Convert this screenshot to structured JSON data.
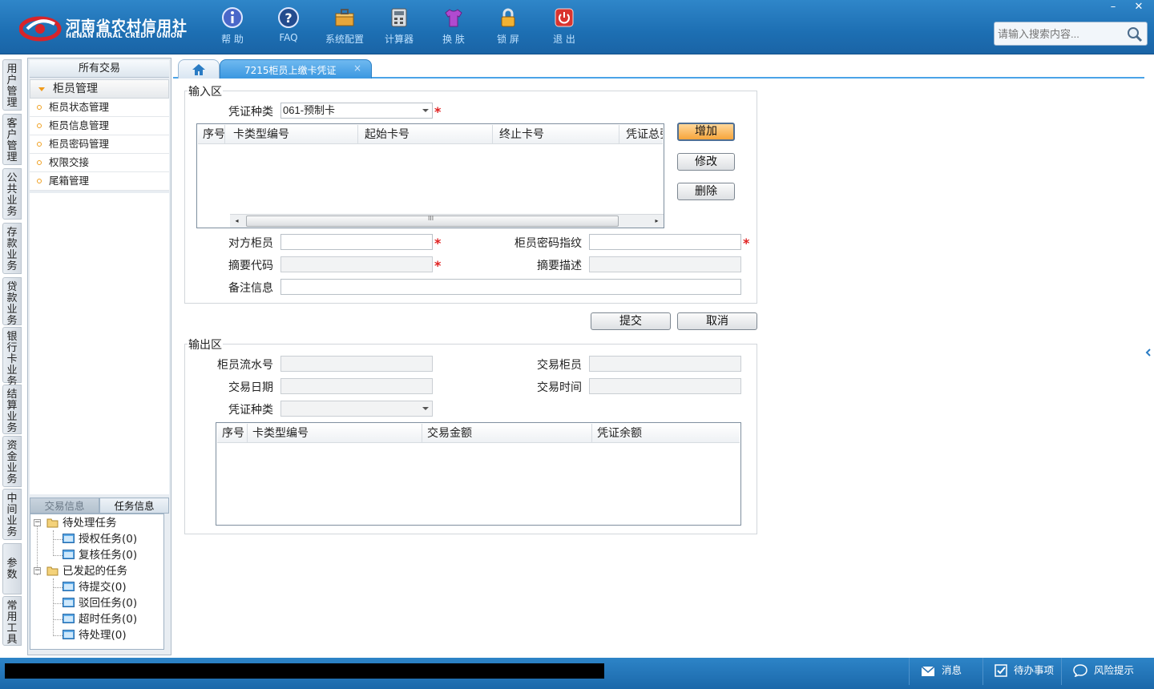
{
  "header": {
    "logo_cn": "河南省农村信用社",
    "logo_en": "HENAN RURAL CREDIT UNION",
    "tools": [
      {
        "label": "帮 助",
        "icon": "info-icon"
      },
      {
        "label": "FAQ",
        "icon": "question-icon"
      },
      {
        "label": "系统配置",
        "icon": "toolbox-icon"
      },
      {
        "label": "计算器",
        "icon": "calculator-icon"
      },
      {
        "label": "换 肤",
        "icon": "shirt-icon"
      },
      {
        "label": "锁 屏",
        "icon": "lock-icon"
      },
      {
        "label": "退 出",
        "icon": "power-icon"
      }
    ],
    "search_placeholder": "请输入搜索内容...",
    "minimize": "–",
    "close": "✕"
  },
  "vtabs": [
    "用户管理",
    "客户管理",
    "公共业务",
    "存款业务",
    "贷款业务",
    "银行卡业务",
    "结算业务",
    "资金业务",
    "中间业务",
    "参数",
    "常用工具"
  ],
  "left_panel": {
    "title": "所有交易",
    "group": "柜员管理",
    "items": [
      "柜员状态管理",
      "柜员信息管理",
      "柜员密码管理",
      "权限交接",
      "尾箱管理"
    ],
    "tabs": [
      "交易信息",
      "任务信息"
    ],
    "tree": {
      "pending": "待处理任务",
      "auth": "授权任务(0)",
      "review": "复核任务(0)",
      "initiated": "已发起的任务",
      "to_submit": "待提交(0)",
      "rejected": "驳回任务(0)",
      "timeout": "超时任务(0)",
      "to_process": "待处理(0)"
    }
  },
  "tabs": {
    "active": "7215柜员上缴卡凭证",
    "close": "×"
  },
  "input_section": {
    "title": "输入区",
    "voucher_type_label": "凭证种类",
    "voucher_type_value": "061-预制卡",
    "grid_columns": [
      "序号",
      "卡类型编号",
      "起始卡号",
      "终止卡号",
      "凭证总张"
    ],
    "scroll_left": "◂",
    "scroll_right": "▸",
    "scroll_grip": "III",
    "add_button": "增加",
    "modify_button": "修改",
    "delete_button": "删除",
    "counterpart_teller_label": "对方柜员",
    "teller_pwd_fp_label": "柜员密码指纹",
    "summary_code_label": "摘要代码",
    "summary_desc_label": "摘要描述",
    "remark_label": "备注信息",
    "required_mark": "*"
  },
  "actions": {
    "submit": "提交",
    "cancel": "取消"
  },
  "output_section": {
    "title": "输出区",
    "serial_label": "柜员流水号",
    "trade_teller_label": "交易柜员",
    "trade_date_label": "交易日期",
    "trade_time_label": "交易时间",
    "voucher_type_label": "凭证种类",
    "grid_columns": [
      "序号",
      "卡类型编号",
      "交易金额",
      "凭证余额"
    ]
  },
  "statusbar": {
    "message": "消息",
    "todo": "待办事项",
    "risk": "风险提示"
  }
}
